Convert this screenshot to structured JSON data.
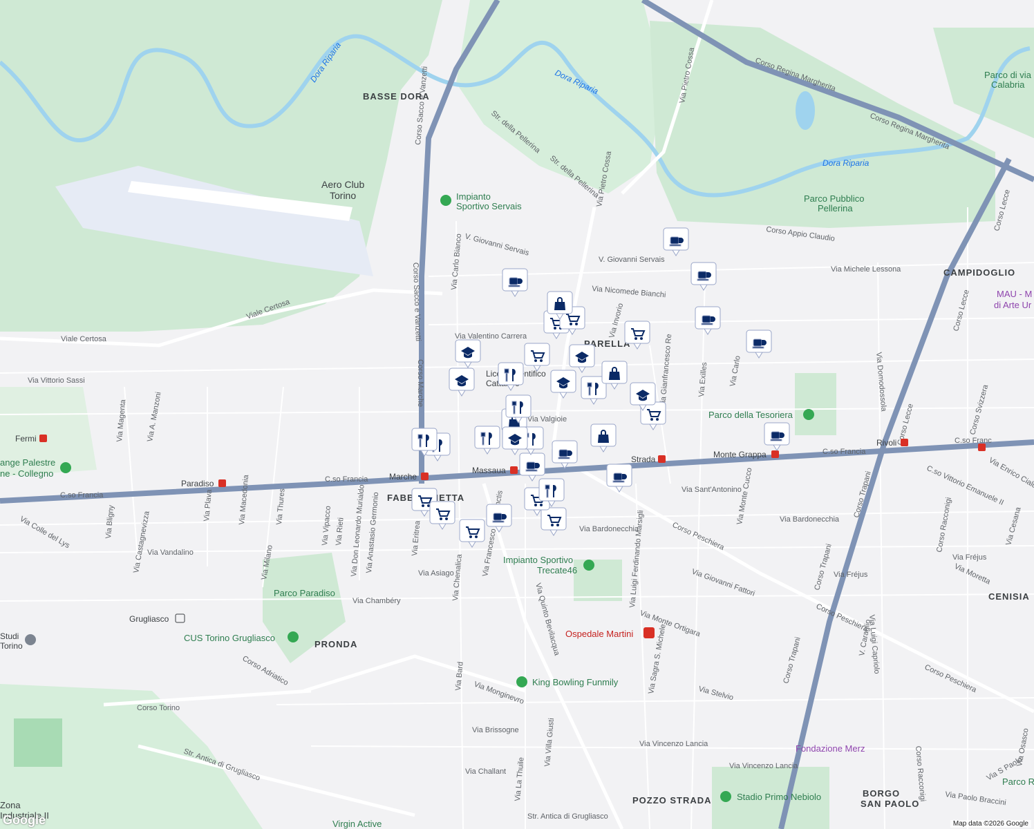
{
  "map": {
    "attribution": "Map data ©2026 Google",
    "logo": "Google",
    "colors": {
      "park": "#cfe9d4",
      "water": "#9fd3ee",
      "highway": "#7f93b5",
      "road": "#ffffff",
      "metro": "#d93025",
      "pin_fill": "#0b2a66"
    },
    "areas": [
      "BASSE DORA",
      "PARELLA",
      "CAMPIDOGLIO",
      "CENISIA",
      "FABBRICHETTA",
      "PRONDA",
      "POZZO STRADA",
      "BORGO",
      "SAN PAOLO"
    ],
    "water_labels": [
      "Dora Riparia",
      "Dora Riparia",
      "Dora Riparia"
    ],
    "streets": [
      "Corso Sacco e Vanzetti",
      "Corso Marche",
      "Viale Certosa",
      "Via Vittorio Sassi",
      "C.so Francia",
      "Via Pietro Cossa",
      "Corso Regina Margherita",
      "Corso Appio Claudio",
      "V. Giovanni Servais",
      "Via Nicomede Bianchi",
      "Via Michele Lessona",
      "Via Valentino Carrera",
      "Via Valgioie",
      "Via Sant'Antonino",
      "Via Bardonecchia",
      "Corso Peschiera",
      "Via Monginevro",
      "Corso Torino",
      "Str. Antica di Grugliasco",
      "Via Vincenzo Lancia",
      "Corso Trapani",
      "Corso Lecce",
      "Via Asiago",
      "Via Chambéry",
      "Via Vandalino",
      "Via Stelvio",
      "Via Brissogne",
      "Via Challant",
      "Str. della Pellerina",
      "Via Carlo Bianco",
      "Via Exilles",
      "Via Giovanni Fattori",
      "Corso Adriatico",
      "Via Luigi Ferdinando Marsigli",
      "Via Quinto Bevilacqua",
      "Via Monte Ortigara",
      "Corso Racconigi",
      "Corso Svizzera",
      "Via Domodossola",
      "C.so Vittorio Emanuele II",
      "Via Francesco De Sanctis",
      "Via Villa Giusti",
      "Via La Thuile",
      "Via Bard",
      "Via Chenalica",
      "Via Eritrea",
      "Via Don Leonardo Murialdo",
      "Via Anastasio Germonio",
      "Via Rieti",
      "Via Vipacco",
      "Via Thures",
      "Via Milano",
      "Via Macedonia",
      "Via Plava",
      "Via Castagnevizza",
      "Via Bligny",
      "Via Magenta",
      "Via A. Manzoni",
      "Via Colle del Lys",
      "Via Monte Cucco",
      "Via Sagra S. Michele",
      "Via Invorio",
      "Via Carlo",
      "Via Fréjus",
      "Via Moretta",
      "Via Luigi Capriolo",
      "V. Caraglio",
      "Via Cesana",
      "Via Enrico Cialdini",
      "Via Osasco",
      "Via S Paolo",
      "Via Paolo Braccini",
      "Via Gianfrancesco Re"
    ],
    "metro_stations": [
      "Fermi",
      "Paradiso",
      "Marche",
      "Massaua",
      "Pozzo Strada",
      "Monte Grappa",
      "Rivoli",
      "Grugliasco"
    ],
    "places": [
      "Aero Club Torino",
      "Impianto Sportivo Servais",
      "Parco Pubblico Pellerina",
      "Parco di via Calabria",
      "MAU - Museo di Arte Urbana",
      "Parco della Tesoriera",
      "Impianto Sportivo Trecate46",
      "Parco Paradiso",
      "CUS Torino Grugliasco",
      "Ospedale Martini",
      "King Bowling Funmily",
      "Fondazione Merz",
      "Stadio Primo Nebiolo",
      "Virgin Active",
      "Lange Palestre - Collegno",
      "Liceo Scientifico Cattaneo",
      "Zona Industriale II",
      "Studi Torino",
      "Parco Ruffini"
    ]
  },
  "pins": [
    {
      "type": "cafe-icon"
    },
    {
      "type": "cafe-icon"
    },
    {
      "type": "cafe-icon"
    },
    {
      "type": "cafe-icon"
    },
    {
      "type": "cafe-icon"
    },
    {
      "type": "shopping-cart-icon"
    },
    {
      "type": "shopping-cart-icon"
    },
    {
      "type": "shopping-cart-icon"
    },
    {
      "type": "shopping-cart-icon"
    },
    {
      "type": "shopping-cart-icon"
    },
    {
      "type": "restaurant-icon"
    },
    {
      "type": "restaurant-icon"
    },
    {
      "type": "restaurant-icon"
    },
    {
      "type": "restaurant-icon"
    },
    {
      "type": "school-icon"
    },
    {
      "type": "school-icon"
    },
    {
      "type": "school-icon"
    },
    {
      "type": "school-icon"
    },
    {
      "type": "school-icon"
    },
    {
      "type": "shopping-bag-icon"
    },
    {
      "type": "shopping-bag-icon"
    },
    {
      "type": "shopping-bag-icon"
    },
    {
      "type": "shopping-bag-icon"
    }
  ]
}
